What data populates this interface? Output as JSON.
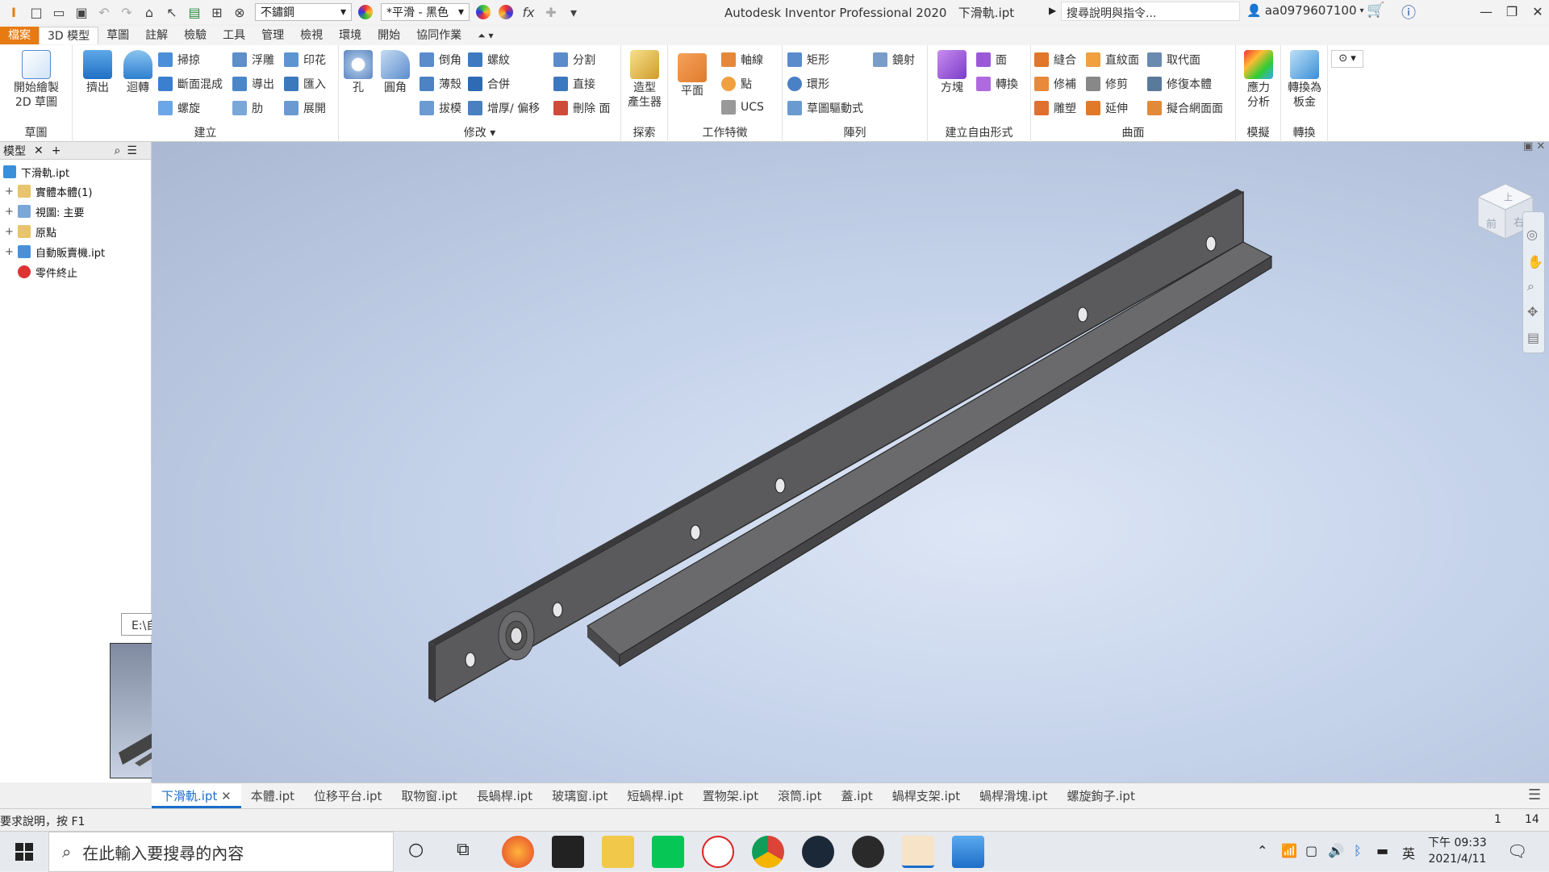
{
  "titlebar": {
    "material": "不鏽鋼",
    "appearance": "*平滑 - 黑色",
    "app_title": "Autodesk Inventor Professional 2020",
    "doc_title": "下滑軌.ipt",
    "search_placeholder": "搜尋說明與指令...",
    "user": "aa0979607100"
  },
  "menu_tabs": [
    "檔案",
    "3D 模型",
    "草圖",
    "註解",
    "檢驗",
    "工具",
    "管理",
    "檢視",
    "環境",
    "開始",
    "協同作業"
  ],
  "ribbon": {
    "groups": [
      {
        "label": "草圖"
      },
      {
        "label": "建立"
      },
      {
        "label": "修改"
      },
      {
        "label": "探索"
      },
      {
        "label": "工作特徵"
      },
      {
        "label": "陣列"
      },
      {
        "label": "建立自由形式"
      },
      {
        "label": "曲面"
      },
      {
        "label": "模擬"
      },
      {
        "label": "轉換"
      }
    ],
    "buttons": {
      "start_sketch": "開始繪製\n2D 草圖",
      "extrude": "擠出",
      "revolve": "迴轉",
      "sweep": "掃掠",
      "loft": "斷面混成",
      "coil": "螺旋",
      "emboss": "浮雕",
      "derive": "導出",
      "rib": "肋",
      "decal": "印花",
      "import": "匯入",
      "unwrap": "展開",
      "hole": "孔",
      "fillet": "圓角",
      "chamfer": "倒角",
      "shell": "薄殼",
      "draft": "拔模",
      "thread": "螺紋",
      "combine": "合併",
      "thicken": "增厚/ 偏移",
      "split": "分割",
      "direct": "直接",
      "delete_face": "刪除 面",
      "shape_generator": "造型\n產生器",
      "plane": "平面",
      "axis": "軸線",
      "point": "點",
      "ucs": "UCS",
      "rect_pattern": "矩形",
      "circ_pattern": "環形",
      "sketch_driven": "草圖驅動式",
      "mirror": "鏡射",
      "box": "方塊",
      "face": "面",
      "convert": "轉換",
      "stitch": "縫合",
      "patch": "修補",
      "sculpt": "雕塑",
      "ruled_surface": "直紋面",
      "trim": "修剪",
      "extend": "延伸",
      "replace_face": "取代面",
      "repair_bodies": "修復本體",
      "fit_mesh": "擬合網面面",
      "stress": "應力\n分析",
      "sheet_metal": "轉換為\n板金"
    }
  },
  "browser": {
    "tab": "模型",
    "items": [
      "下滑軌.ipt",
      "實體本體(1)",
      "視圖: 主要",
      "原點",
      "自動販賣機.ipt",
      "零件終止"
    ],
    "tooltip": "E:\\自動販賣機\\下滑軌.ipt"
  },
  "viewcube": {
    "face_front": "前",
    "face_right": "右",
    "face_top": "上"
  },
  "doc_tabs": [
    "下滑軌.ipt",
    "本體.ipt",
    "位移平台.ipt",
    "取物窗.ipt",
    "長蝸桿.ipt",
    "玻璃窗.ipt",
    "短蝸桿.ipt",
    "置物架.ipt",
    "滾筒.ipt",
    "蓋.ipt",
    "蝸桿支架.ipt",
    "蝸桿滑塊.ipt",
    "螺旋鉤子.ipt"
  ],
  "status": {
    "help": "要求說明，按 F1",
    "count1": "1",
    "count2": "14"
  },
  "taskbar": {
    "search": "在此輸入要搜尋的內容",
    "lang": "英",
    "time": "下午 09:33",
    "date": "2021/4/11"
  }
}
